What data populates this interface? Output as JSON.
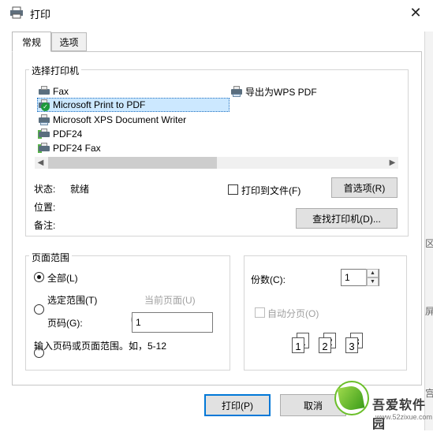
{
  "window": {
    "title": "打印"
  },
  "tabs": [
    {
      "label": "常规"
    },
    {
      "label": "选项"
    }
  ],
  "printer_group": {
    "title": "选择打印机",
    "printers": [
      {
        "name": "Fax",
        "icon": "fax-printer-icon"
      },
      {
        "name": "导出为WPS PDF",
        "icon": "printer-icon"
      },
      {
        "name": "Microsoft Print to PDF",
        "icon": "default-printer-icon",
        "selected": true
      },
      {
        "name": "Microsoft XPS Document Writer",
        "icon": "printer-icon"
      },
      {
        "name": "PDF24",
        "icon": "printer-icon"
      },
      {
        "name": "PDF24 Fax",
        "icon": "printer-icon"
      }
    ],
    "status_label": "状态:",
    "status_value": "就绪",
    "location_label": "位置:",
    "comment_label": "备注:",
    "print_to_file_label": "打印到文件(F)",
    "preferences_button": "首选项(R)",
    "find_printer_button": "查找打印机(D)..."
  },
  "page_range": {
    "title": "页面范围",
    "all_label": "全部(L)",
    "selection_label": "选定范围(T)",
    "current_page_label": "当前页面(U)",
    "pages_label": "页码(G):",
    "pages_value": "1",
    "hint": "输入页码或页面范围。如，5-12"
  },
  "copies": {
    "label": "份数(C):",
    "value": "1",
    "collate_label": "自动分页(O)",
    "collate_pages": [
      "1",
      "1",
      "2",
      "2",
      "3",
      "3"
    ]
  },
  "buttons": {
    "print": "打印(P)",
    "cancel": "取消"
  },
  "edge_glyphs": [
    "区",
    "屏",
    "宫"
  ],
  "watermark": {
    "text": "吾爱软件园",
    "url": "www.52zixue.com"
  },
  "colors": {
    "accent": "#0078d7",
    "selection": "#cce8ff"
  }
}
